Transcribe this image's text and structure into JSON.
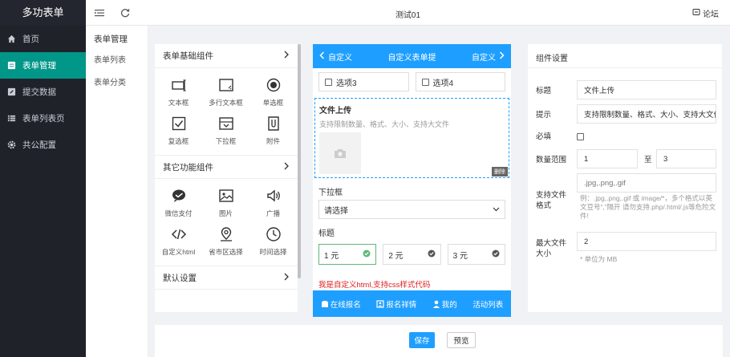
{
  "sidebar": {
    "brand": "多功表单",
    "items": [
      {
        "label": "首页",
        "icon": "home-icon"
      },
      {
        "label": "表单管理",
        "icon": "form-icon",
        "active": true
      },
      {
        "label": "提交数据",
        "icon": "edit-icon"
      },
      {
        "label": "表单列表页",
        "icon": "list-icon"
      },
      {
        "label": "共公配置",
        "icon": "gear-icon"
      }
    ]
  },
  "topbar": {
    "title": "测试01",
    "forum": "论坛"
  },
  "subnav": {
    "head": "表单管理",
    "links": [
      "表单列表",
      "表单分类"
    ]
  },
  "components": {
    "basic_title": "表单基础组件",
    "basic": [
      "文本框",
      "多行文本框",
      "单选框",
      "复选框",
      "下拉框",
      "附件"
    ],
    "other_title": "其它功能组件",
    "other": [
      "微信支付",
      "图片",
      "广播",
      "自定义html",
      "省市区选择",
      "时间选择"
    ],
    "default_title": "默认设置"
  },
  "phone": {
    "header_left": "自定义",
    "header_title": "自定义表单提",
    "header_right": "自定义",
    "options": [
      "选项3",
      "选项4"
    ],
    "upload_label": "文件上传",
    "upload_hint": "支持限制数量、格式、大小、支持大文件",
    "delete_label": "删除",
    "select_label": "下拉框",
    "select_placeholder": "请选择",
    "price_label": "标题",
    "prices": [
      "1 元",
      "2 元",
      "3 元"
    ],
    "custom_html_text": "我是自定义html,支持css样式代码",
    "footer": [
      "在线报名",
      "报名祥情",
      "我的",
      "活动列表"
    ]
  },
  "settings": {
    "title": "组件设置",
    "title_label": "标题",
    "title_value": "文件上传",
    "hint_label": "提示",
    "hint_value": "支持限制数量、格式、大小、支持大文件",
    "required_label": "必填",
    "count_label": "数量范围",
    "count_min": "1",
    "count_to": "至",
    "count_max": "3",
    "format_label": "支持文件格式",
    "format_value": ".jpg,.png,.gif",
    "format_hint": "例：.jpg,.png,.gif 或 image/*，多个格式以英文豆号“,”隔开 请勿支持.php/.html/.js等危险文件!",
    "size_label": "最大文件大小",
    "size_value": "2",
    "size_hint": "* 单位为 MB"
  },
  "actions": {
    "save": "保存",
    "preview": "预览"
  },
  "colors": {
    "accent": "#1e9fff",
    "active_nav": "#009688",
    "sidebar": "#20222a"
  }
}
